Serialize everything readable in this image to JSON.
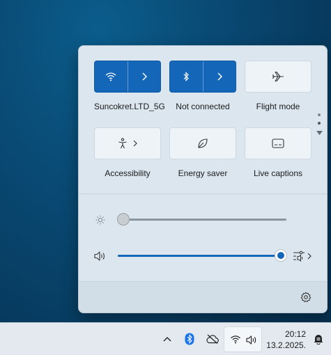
{
  "quick_settings": {
    "tiles": [
      {
        "label": "Suncokret.LTD_5G",
        "icon": "wifi-icon",
        "state": "on"
      },
      {
        "label": "Not connected",
        "icon": "bluetooth-icon",
        "state": "on"
      },
      {
        "label": "Flight mode",
        "icon": "airplane-icon",
        "state": "off"
      },
      {
        "label": "Accessibility",
        "icon": "accessibility-icon",
        "state": "off"
      },
      {
        "label": "Energy saver",
        "icon": "leaf-icon",
        "state": "off"
      },
      {
        "label": "Live captions",
        "icon": "captions-icon",
        "state": "off"
      }
    ],
    "brightness": {
      "icon": "sun-icon",
      "level": 0.0
    },
    "volume": {
      "icon": "speaker-icon",
      "level": 1.0,
      "mixer_icon": "audio-mixer-icon"
    },
    "settings_icon": "gear-icon"
  },
  "taskbar": {
    "icons": [
      "chevron-up-icon",
      "bluetooth-icon",
      "cloud-off-icon",
      "wifi-icon",
      "speaker-icon",
      "notification-icon"
    ],
    "time": "20:12",
    "date": "13.2.2025."
  },
  "colors": {
    "accent": "#1466b8",
    "panel": "#dbe6ee",
    "taskbar": "#e3e9ee"
  }
}
